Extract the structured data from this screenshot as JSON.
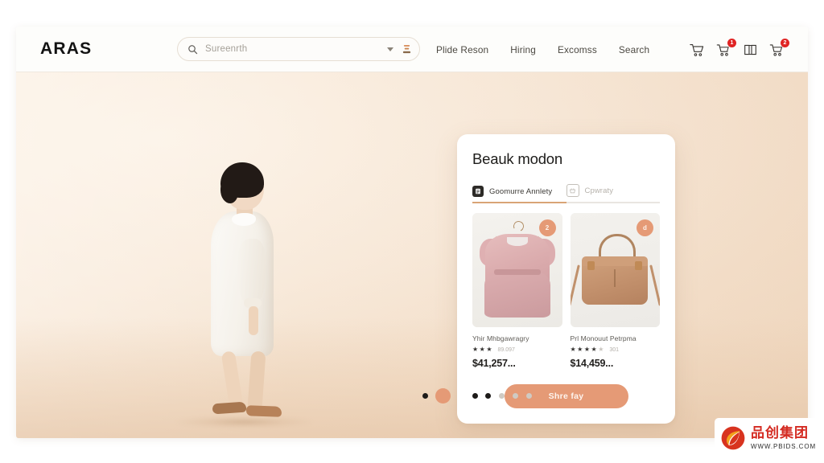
{
  "brand": {
    "name": "ARAS"
  },
  "search": {
    "placeholder": "Sureenrth",
    "icon": "search-icon",
    "dropdown_icon": "chevron-down-icon",
    "action_icon": "filter-icon"
  },
  "nav": {
    "links": [
      {
        "label": "Plide Reson"
      },
      {
        "label": "Hiring"
      },
      {
        "label": "Excomss"
      },
      {
        "label": "Search"
      }
    ],
    "icons": [
      {
        "name": "cart-icon",
        "badge": ""
      },
      {
        "name": "cart-alert-icon",
        "badge": "1"
      },
      {
        "name": "book-icon",
        "badge": ""
      },
      {
        "name": "cart-notification-icon",
        "badge": "2"
      }
    ]
  },
  "hero": {
    "alt": "child-walking-white-dress",
    "background_color": "#f4e0cb"
  },
  "panel": {
    "title": "Beauk modon",
    "tabs": [
      {
        "label": "Goomurre Annlety",
        "icon": "document-solid-icon",
        "active": true
      },
      {
        "label": "Cpwraty",
        "icon": "basket-outline-icon",
        "active": false
      }
    ],
    "accent_color": "#e59a76",
    "underline_color": "#d9a476",
    "products": [
      {
        "name": "Yhir Mhbgawragry",
        "badge": "2",
        "stars": 3,
        "stars_total": 5,
        "rating_count": "89.097",
        "price": "$41,257...",
        "image": "pink-dress-on-hanger"
      },
      {
        "name": "Prl Monouut Petrpma",
        "badge": "d",
        "stars": 4,
        "stars_total": 5,
        "rating_count": "301",
        "price": "$14,459...",
        "image": "tan-leather-handbag"
      }
    ],
    "cta_label": "Shre fay"
  },
  "carousel": {
    "dots": [
      {
        "style": "small-dark",
        "active": false
      },
      {
        "style": "large-accent",
        "active": true
      },
      {
        "style": "small-dark",
        "active": false
      },
      {
        "style": "small-dark",
        "active": false
      },
      {
        "style": "small-grey",
        "active": false
      },
      {
        "style": "small-grey",
        "active": false
      },
      {
        "style": "small-grey",
        "active": false
      }
    ]
  },
  "watermark": {
    "cn_text": "品创集团",
    "url": "WWW.PBIDS.COM",
    "logo": "pbids-leaf-logo"
  }
}
